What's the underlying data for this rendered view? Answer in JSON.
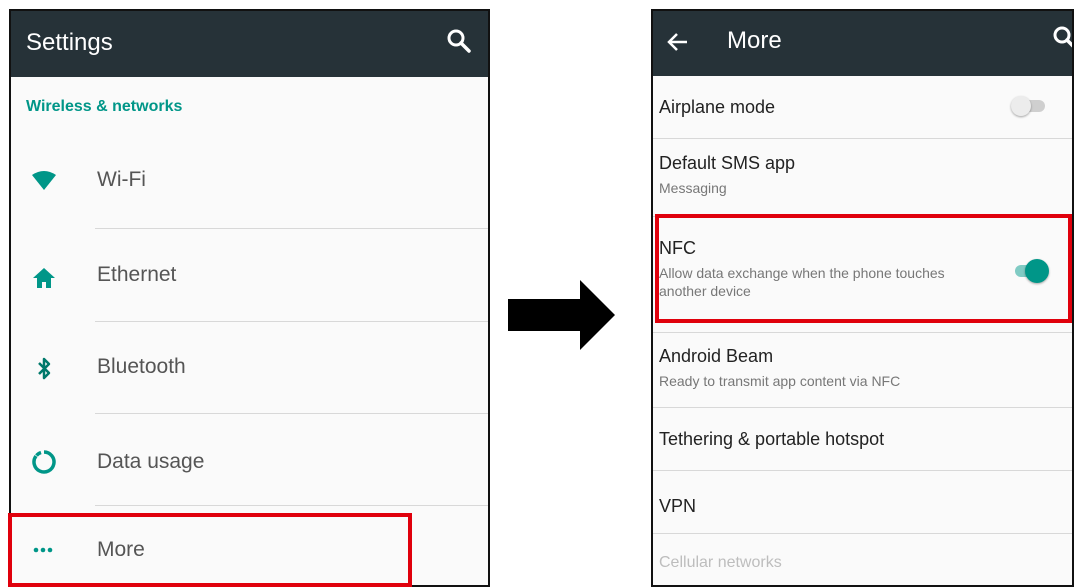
{
  "left": {
    "title": "Settings",
    "section": "Wireless & networks",
    "items": [
      {
        "label": "Wi-Fi",
        "icon": "wifi-icon"
      },
      {
        "label": "Ethernet",
        "icon": "home-icon"
      },
      {
        "label": "Bluetooth",
        "icon": "bluetooth-icon"
      },
      {
        "label": "Data usage",
        "icon": "data-usage-icon"
      },
      {
        "label": "More",
        "icon": "more-dots-icon"
      }
    ]
  },
  "right": {
    "title": "More",
    "items": [
      {
        "title": "Airplane mode",
        "toggle": "off"
      },
      {
        "title": "Default SMS app",
        "subtitle": "Messaging"
      },
      {
        "title": "NFC",
        "subtitle": "Allow data exchange when the phone touches another device",
        "toggle": "on"
      },
      {
        "title": "Android Beam",
        "subtitle": "Ready to transmit app content via NFC"
      },
      {
        "title": "Tethering & portable hotspot"
      },
      {
        "title": "VPN"
      },
      {
        "title": "Cellular networks",
        "disabled": true
      }
    ]
  },
  "colors": {
    "accent": "#009688",
    "toolbar": "#263238",
    "highlight": "#e0000c"
  }
}
